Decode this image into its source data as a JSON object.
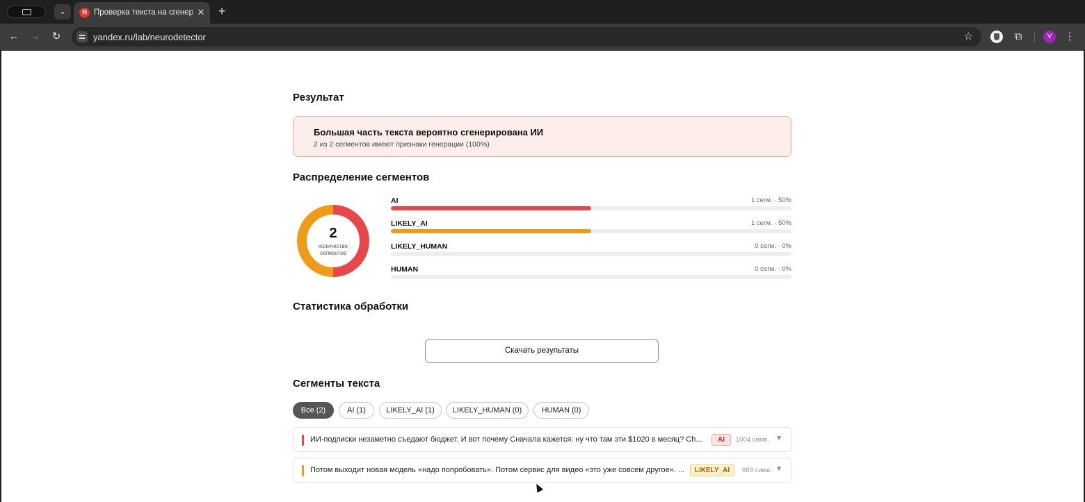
{
  "browser": {
    "tab_title": "Проверка текста на сгенерированность",
    "favicon_letter": "Я",
    "url": "yandex.ru/lab/neurodetector",
    "avatar_letter": "V"
  },
  "result": {
    "heading": "Результат",
    "main": "Большая часть текста вероятно сгенерирована ИИ",
    "sub": "2 из 2 сегментов имеют признаки генерации (100%)"
  },
  "distribution": {
    "heading": "Распределение сегментов",
    "total": "2",
    "total_label": "количество сегментов",
    "rows": [
      {
        "name": "AI",
        "meta": "1 сегм. · 50%",
        "fraction": 0.5,
        "color": "#e8474a"
      },
      {
        "name": "LIKELY_AI",
        "meta": "1 сегм. · 50%",
        "fraction": 0.5,
        "color": "#f09a1a"
      },
      {
        "name": "LIKELY_HUMAN",
        "meta": "0 сегм. · 0%",
        "fraction": 0,
        "color": "#8ab4f8"
      },
      {
        "name": "HUMAN",
        "meta": "0 сегм. · 0%",
        "fraction": 0,
        "color": "#4caf50"
      }
    ]
  },
  "stats": {
    "heading": "Статистика обработки"
  },
  "download": {
    "label": "Скачать результаты"
  },
  "segments": {
    "heading": "Сегменты текста",
    "filters": [
      {
        "label": "Все (2)",
        "active": true
      },
      {
        "label": "AI (1)",
        "active": false
      },
      {
        "label": "LIKELY_AI (1)",
        "active": false
      },
      {
        "label": "LIKELY_HUMAN (0)",
        "active": false
      },
      {
        "label": "HUMAN (0)",
        "active": false
      }
    ],
    "items": [
      {
        "text": "ИИ-подписки незаметно съедают бюджет. И вот почему Сначала кажется: ну что там эти $1020 в месяц? Ch...",
        "badge": "AI",
        "chars": "1004 симв.",
        "color": "#e8474a",
        "badge_bg": "#fde3e1",
        "badge_border": "#f2a7a0",
        "badge_fg": "#c62828"
      },
      {
        "text": "Потом выходит новая модель «надо попробовать». Потом сервис для видео «это уже совсем другое». ...",
        "badge": "LIKELY_AI",
        "chars": "889 симв.",
        "color": "#f09a1a",
        "badge_bg": "#fff2cf",
        "badge_border": "#f3cf6d",
        "badge_fg": "#a65d00"
      }
    ]
  },
  "colors": {
    "ai": "#e8474a",
    "likely_ai": "#f09a1a"
  }
}
